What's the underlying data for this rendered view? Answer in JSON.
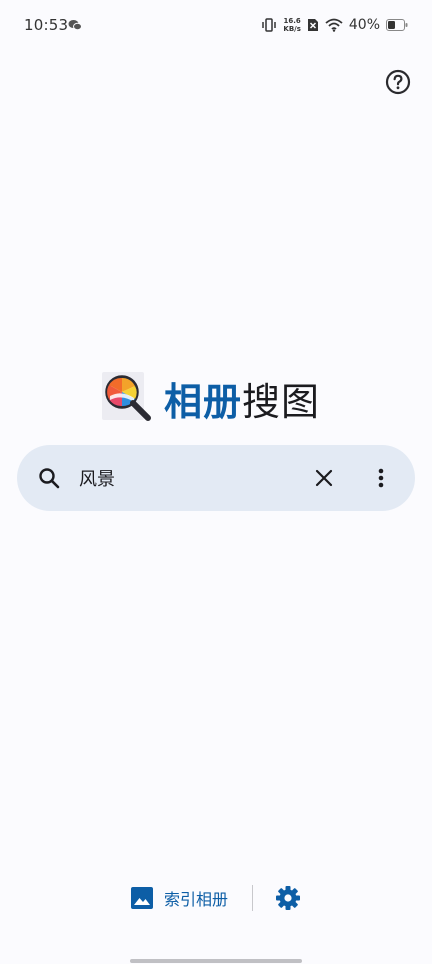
{
  "status_bar": {
    "time": "10:53",
    "net_speed_value": "16.6",
    "net_speed_unit": "KB/s",
    "battery_percent": "40%"
  },
  "app": {
    "title_accent": "相册",
    "title_rest": "搜图"
  },
  "search": {
    "query": "风景"
  },
  "actions": {
    "index_album_label": "索引相册"
  },
  "colors": {
    "accent": "#0d5ea6",
    "search_bg": "#e3eaf4",
    "page_bg": "#fbfbfe"
  }
}
